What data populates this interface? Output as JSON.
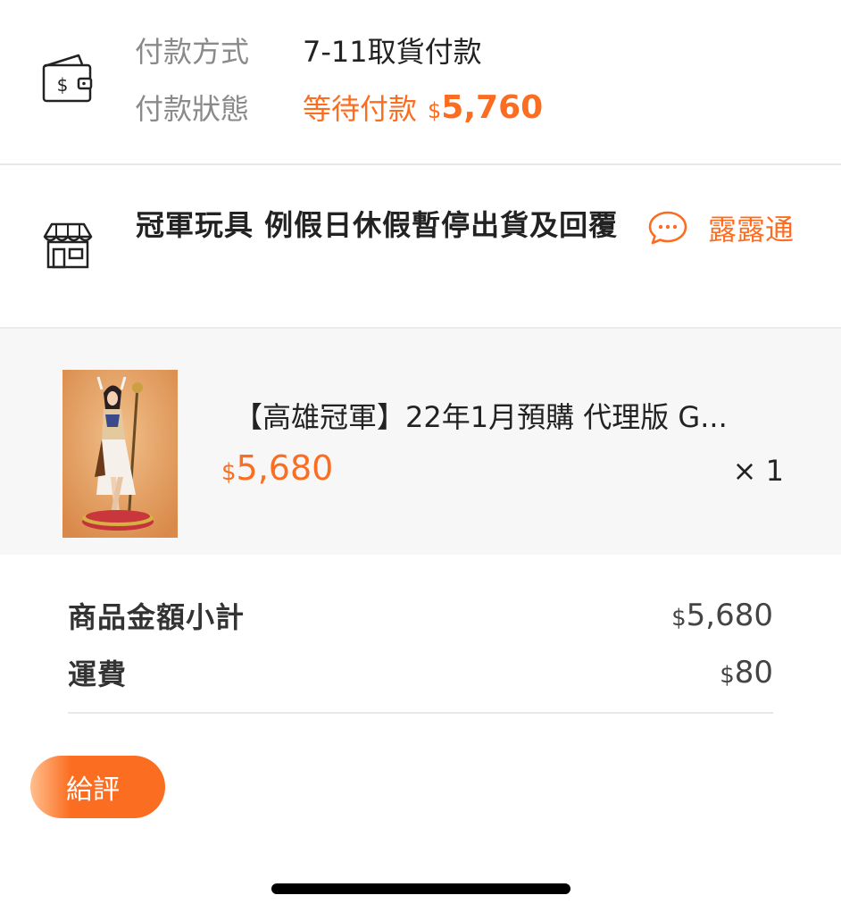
{
  "payment": {
    "method_label": "付款方式",
    "method_value": "7-11取貨付款",
    "status_label": "付款狀態",
    "status_value": "等待付款",
    "currency_symbol": "$",
    "amount": "5,760",
    "icon": "wallet-icon"
  },
  "shop": {
    "name": "冠軍玩具 例假日休假暫停出貨及回覆",
    "icon": "store-icon",
    "chat_label": "露露通",
    "chat_icon": "chat-bubble-icon"
  },
  "product": {
    "title": "【高雄冠軍】22年1月預購 代理版 G...",
    "currency_symbol": "$",
    "price": "5,680",
    "quantity": "× 1"
  },
  "summary": {
    "subtotal_label": "商品金額小計",
    "subtotal_currency": "$",
    "subtotal_value": "5,680",
    "shipping_label": "運費",
    "shipping_currency": "$",
    "shipping_value": "80"
  },
  "actions": {
    "review_label": "給評"
  },
  "colors": {
    "accent": "#fb6d21",
    "muted_text": "#8a8a8a",
    "product_bg": "#f7f7f7"
  }
}
